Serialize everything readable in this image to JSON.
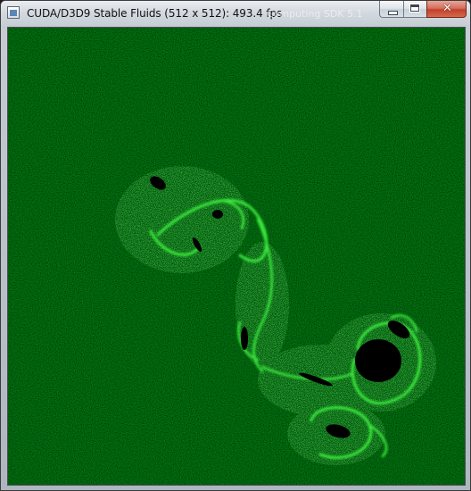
{
  "window": {
    "title": "CUDA/D3D9 Stable Fluids (512 x 512): 493.4 fps",
    "background_title_fragment": "Computing SDK 5.1",
    "icon": "application-window-icon",
    "caption_buttons": {
      "minimize_icon": "minimize-icon",
      "maximize_icon": "maximize-icon",
      "close_icon": "close-icon",
      "close_glyph": "✕"
    }
  },
  "simulation": {
    "grid_size": "512 x 512",
    "fps": 493.4,
    "colors": {
      "fluid_field": "#0a6e12",
      "highlight": "#3cff3c",
      "vortex_core": "#000000"
    }
  }
}
